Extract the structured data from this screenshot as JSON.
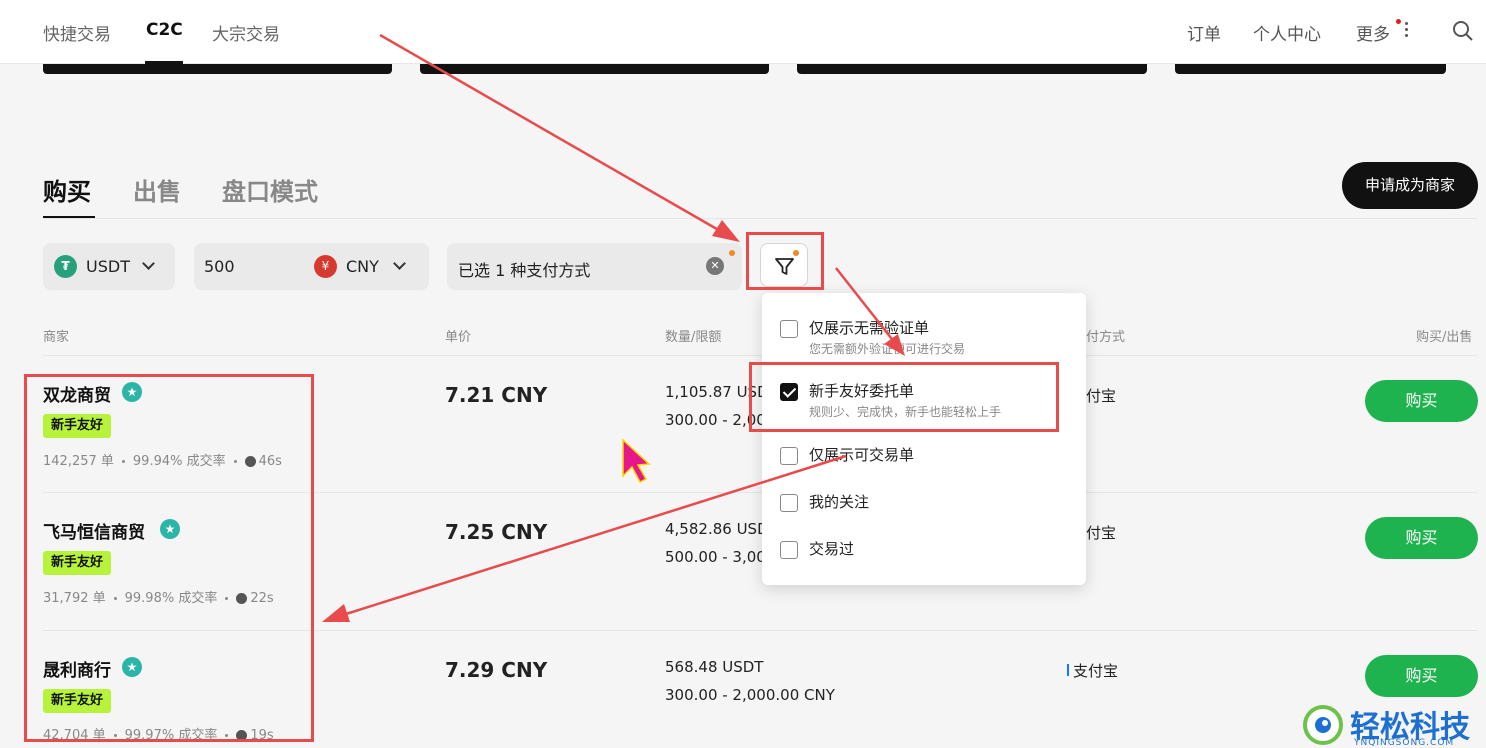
{
  "nav": {
    "tabs": [
      "快捷交易",
      "C2C",
      "大宗交易"
    ],
    "orders": "订单",
    "profile": "个人中心",
    "more": "更多"
  },
  "trade_tabs": [
    "购买",
    "出售",
    "盘口模式"
  ],
  "apply_merchant": "申请成为商家",
  "filters": {
    "crypto": "USDT",
    "amount": "500",
    "fiat": "CNY",
    "fiat_symbol": "¥",
    "payment": "已选 1 种支付方式"
  },
  "table_headers": {
    "merchant": "商家",
    "price": "单价",
    "quantity": "数量/限额",
    "payment": "付方式",
    "action": "购买/出售"
  },
  "rows": [
    {
      "name": "双龙商贸",
      "tag": "新手友好",
      "orders": "142,257 单",
      "rate": "99.94% 成交率",
      "time": "46s",
      "price": "7.21 CNY",
      "qty": "1,105.87 USD",
      "limit": "300.00 - 2,00",
      "payment": "付宝",
      "button": "购买"
    },
    {
      "name": "飞马恒信商贸",
      "tag": "新手友好",
      "orders": "31,792 单",
      "rate": "99.98% 成交率",
      "time": "22s",
      "price": "7.25 CNY",
      "qty": "4,582.86 USD",
      "limit": "500.00 - 3,00",
      "payment": "付宝",
      "button": "购买"
    },
    {
      "name": "晟利商行",
      "tag": "新手友好",
      "orders": "42,704 单",
      "rate": "99.97% 成交率",
      "time": "19s",
      "price": "7.29 CNY",
      "qty": "568.48 USDT",
      "limit": "300.00 - 2,000.00 CNY",
      "payment": "支付宝",
      "button": "购买"
    }
  ],
  "filter_menu": [
    {
      "label": "仅展示无需验证单",
      "sub": "您无需额外验证便可进行交易",
      "checked": false
    },
    {
      "label": "新手友好委托单",
      "sub": "规则少、完成快，新手也能轻松上手",
      "checked": true
    },
    {
      "label": "仅展示可交易单",
      "checked": false
    },
    {
      "label": "我的关注",
      "checked": false
    },
    {
      "label": "交易过",
      "checked": false
    }
  ],
  "watermark": {
    "text": "轻松科技",
    "sub": "YNQINGSONG.COM"
  },
  "colors": {
    "buy_green": "#1fb34f",
    "newbie_tag": "#b6f33a",
    "annotation_red": "#e84b4b"
  }
}
